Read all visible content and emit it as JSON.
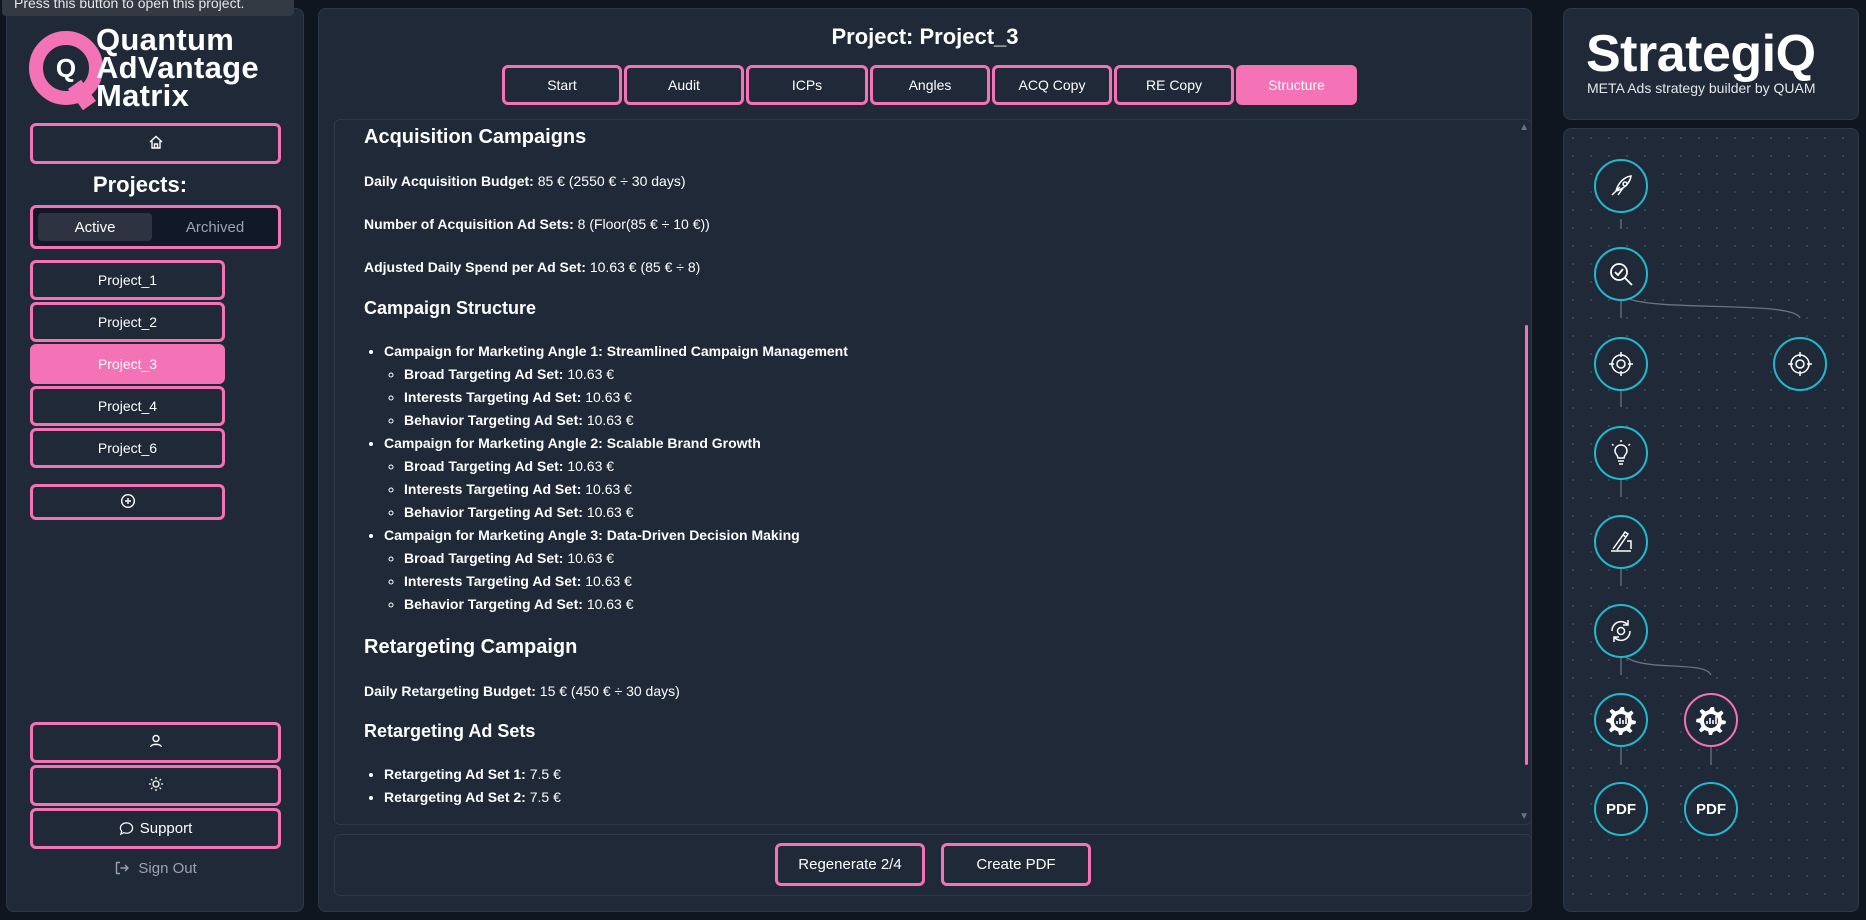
{
  "tooltip": "Press this button to open this project.",
  "sidebar": {
    "logo_lines": [
      "Quantum",
      "AdVantage",
      "Matrix"
    ],
    "projects_label": "Projects:",
    "filter": {
      "active": "Active",
      "archived": "Archived"
    },
    "projects": [
      "Project_1",
      "Project_2",
      "Project_3",
      "Project_4",
      "Project_6"
    ],
    "selected_project": "Project_3",
    "support": "Support",
    "sign_out": "Sign Out"
  },
  "main": {
    "title": "Project: Project_3",
    "tabs": [
      "Start",
      "Audit",
      "ICPs",
      "Angles",
      "ACQ Copy",
      "RE Copy",
      "Structure"
    ],
    "active_tab": "Structure",
    "doc": {
      "acq_heading": "Acquisition Campaigns",
      "daily_budget_label": "Daily Acquisition Budget:",
      "daily_budget_value": "85 € (2550 € ÷ 30 days)",
      "num_sets_label": "Number of Acquisition Ad Sets:",
      "num_sets_value": "8 (Floor(85 € ÷ 10 €))",
      "adjusted_label": "Adjusted Daily Spend per Ad Set:",
      "adjusted_value": "10.63 € (85 € ÷ 8)",
      "structure_heading": "Campaign Structure",
      "campaigns": [
        {
          "title": "Campaign for Marketing Angle 1: Streamlined Campaign Management",
          "sets": [
            {
              "label": "Broad Targeting Ad Set:",
              "value": "10.63 €"
            },
            {
              "label": "Interests Targeting Ad Set:",
              "value": "10.63 €"
            },
            {
              "label": "Behavior Targeting Ad Set:",
              "value": "10.63 €"
            }
          ]
        },
        {
          "title": "Campaign for Marketing Angle 2: Scalable Brand Growth",
          "sets": [
            {
              "label": "Broad Targeting Ad Set:",
              "value": "10.63 €"
            },
            {
              "label": "Interests Targeting Ad Set:",
              "value": "10.63 €"
            },
            {
              "label": "Behavior Targeting Ad Set:",
              "value": "10.63 €"
            }
          ]
        },
        {
          "title": "Campaign for Marketing Angle 3: Data-Driven Decision Making",
          "sets": [
            {
              "label": "Broad Targeting Ad Set:",
              "value": "10.63 €"
            },
            {
              "label": "Interests Targeting Ad Set:",
              "value": "10.63 €"
            },
            {
              "label": "Behavior Targeting Ad Set:",
              "value": "10.63 €"
            }
          ]
        }
      ],
      "retarget_heading": "Retargeting Campaign",
      "retarget_budget_label": "Daily Retargeting Budget:",
      "retarget_budget_value": "15 € (450 € ÷ 30 days)",
      "retarget_sets_heading": "Retargeting Ad Sets",
      "retarget_sets": [
        {
          "label": "Retargeting Ad Set 1:",
          "value": "7.5 €"
        },
        {
          "label": "Retargeting Ad Set 2:",
          "value": "7.5 €"
        }
      ]
    },
    "regenerate": "Regenerate 2/4",
    "create_pdf": "Create PDF"
  },
  "brand": {
    "name": "StrategiQ",
    "tagline": "META Ads strategy builder by QUAM"
  },
  "flow": {
    "pdf_label": "PDF",
    "nodes": [
      "rocket-icon",
      "audit-search-icon",
      "icp-target-icon",
      "icp-target-icon",
      "idea-bulb-icon",
      "copywriting-hand-icon",
      "retarget-cycle-icon",
      "structure-gear-icon",
      "structure-gear-icon",
      "pdf-icon",
      "pdf-icon"
    ]
  },
  "colors": {
    "accent": "#f472b6",
    "teal": "#22b8cf",
    "panel": "#1f2937",
    "background": "#0f1620"
  }
}
